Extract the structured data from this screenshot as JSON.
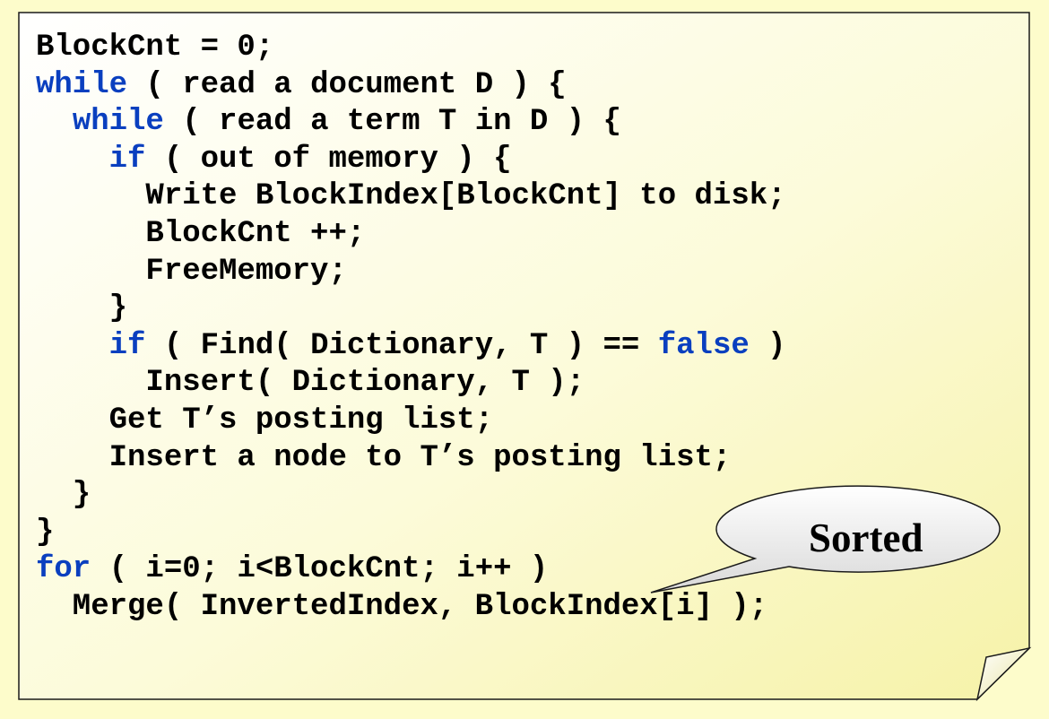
{
  "code_lines": [
    [
      {
        "text": "BlockCnt = 0;",
        "kw": false
      }
    ],
    [
      {
        "text": "while",
        "kw": true
      },
      {
        "text": " ( read a document D ) {",
        "kw": false
      }
    ],
    [
      {
        "text": "  ",
        "kw": false
      },
      {
        "text": "while",
        "kw": true
      },
      {
        "text": " ( read a term T in D ) {",
        "kw": false
      }
    ],
    [
      {
        "text": "    ",
        "kw": false
      },
      {
        "text": "if",
        "kw": true
      },
      {
        "text": " ( out of memory ) {",
        "kw": false
      }
    ],
    [
      {
        "text": "      Write BlockIndex[BlockCnt] to disk;",
        "kw": false
      }
    ],
    [
      {
        "text": "      BlockCnt ++;",
        "kw": false
      }
    ],
    [
      {
        "text": "      FreeMemory;",
        "kw": false
      }
    ],
    [
      {
        "text": "    }",
        "kw": false
      }
    ],
    [
      {
        "text": "    ",
        "kw": false
      },
      {
        "text": "if",
        "kw": true
      },
      {
        "text": " ( Find( Dictionary, T ) == ",
        "kw": false
      },
      {
        "text": "false",
        "kw": true
      },
      {
        "text": " )",
        "kw": false
      }
    ],
    [
      {
        "text": "      Insert( Dictionary, T );",
        "kw": false
      }
    ],
    [
      {
        "text": "    Get T’s posting list;",
        "kw": false
      }
    ],
    [
      {
        "text": "    Insert a node to T’s posting list;",
        "kw": false
      }
    ],
    [
      {
        "text": "  }",
        "kw": false
      }
    ],
    [
      {
        "text": "}",
        "kw": false
      }
    ],
    [
      {
        "text": "for",
        "kw": true
      },
      {
        "text": " ( i=0; i<BlockCnt; i++ )",
        "kw": false
      }
    ],
    [
      {
        "text": "  Merge( InvertedIndex, BlockIndex[i] );",
        "kw": false
      }
    ]
  ],
  "callout": {
    "label": "Sorted"
  },
  "colors": {
    "background": "#fdfccb",
    "keyword": "#0a3fbf",
    "text": "#000000"
  }
}
